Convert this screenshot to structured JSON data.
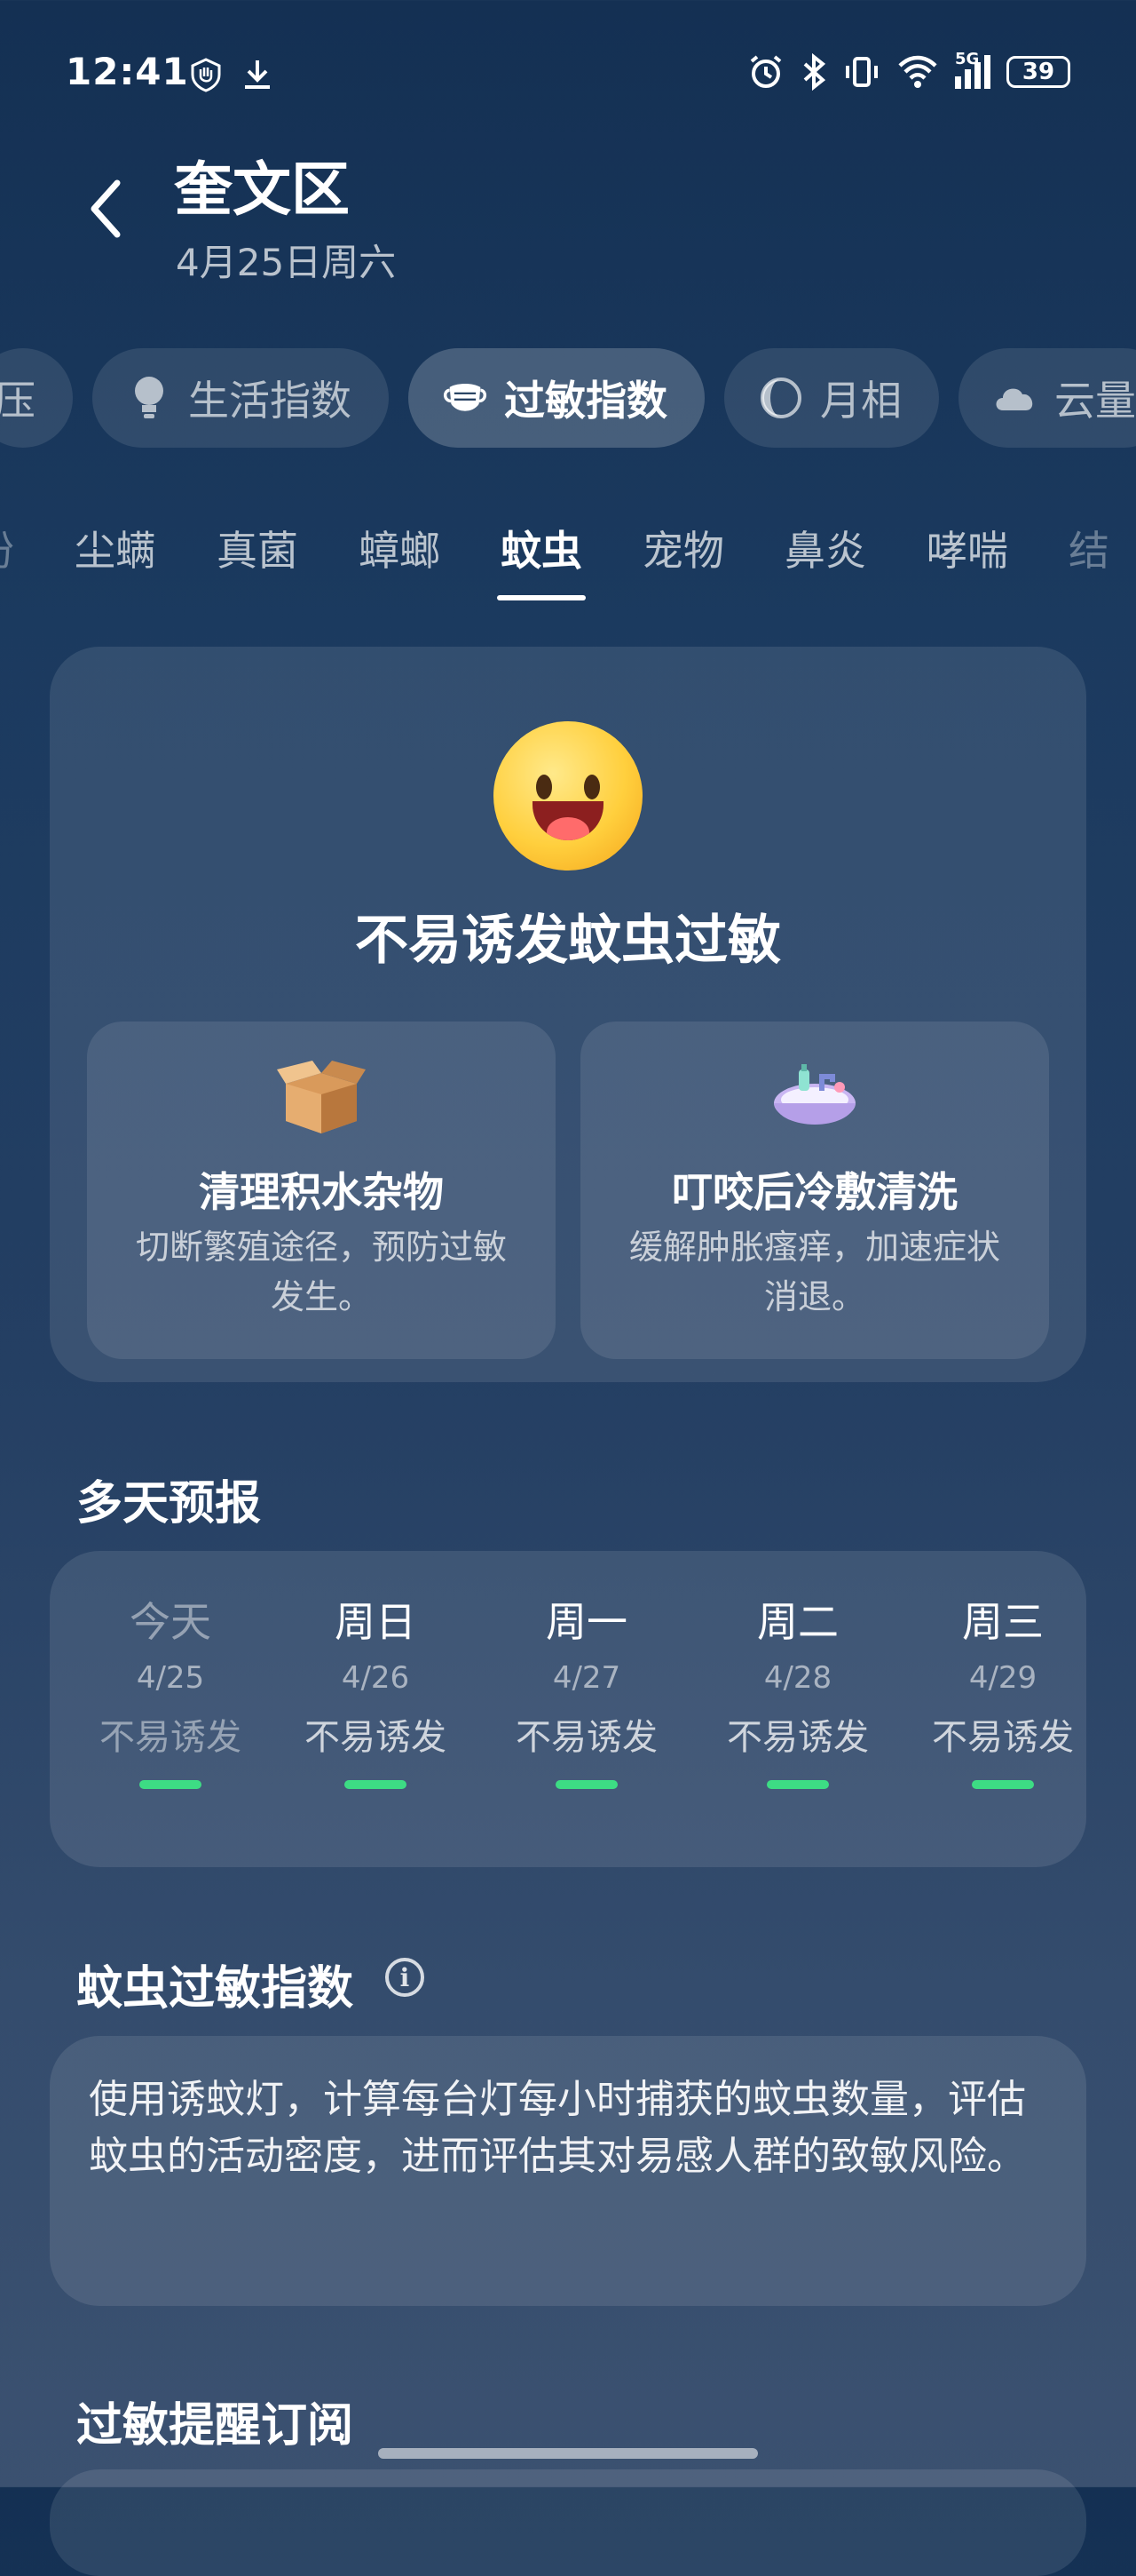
{
  "status_bar": {
    "time": "12:41",
    "network": "5G",
    "battery": "39"
  },
  "header": {
    "title": "奎文区",
    "date": "4月25日周六"
  },
  "categories": [
    {
      "label": "压",
      "icon": "gauge-icon"
    },
    {
      "label": "生活指数",
      "icon": "lightbulb-icon"
    },
    {
      "label": "过敏指数",
      "icon": "mask-icon",
      "active": true
    },
    {
      "label": "月相",
      "icon": "moon-icon"
    },
    {
      "label": "云量",
      "icon": "cloud-icon"
    }
  ],
  "allergen_tabs": [
    {
      "label": "粉"
    },
    {
      "label": "尘螨"
    },
    {
      "label": "真菌"
    },
    {
      "label": "蟑螂"
    },
    {
      "label": "蚊虫",
      "active": true
    },
    {
      "label": "宠物"
    },
    {
      "label": "鼻炎"
    },
    {
      "label": "哮喘"
    },
    {
      "label": "结"
    }
  ],
  "summary": {
    "headline": "不易诱发蚊虫过敏",
    "tips": [
      {
        "icon": "box-icon",
        "title": "清理积水杂物",
        "desc": "切断繁殖途径，预防过敏发生。"
      },
      {
        "icon": "sink-icon",
        "title": "叮咬后冷敷清洗",
        "desc": "缓解肿胀瘙痒，加速症状消退。"
      }
    ]
  },
  "forecast": {
    "title": "多天预报",
    "days": [
      {
        "name": "今天",
        "date": "4/25",
        "level": "不易诱发"
      },
      {
        "name": "周日",
        "date": "4/26",
        "level": "不易诱发"
      },
      {
        "name": "周一",
        "date": "4/27",
        "level": "不易诱发"
      },
      {
        "name": "周二",
        "date": "4/28",
        "level": "不易诱发"
      },
      {
        "name": "周三",
        "date": "4/29",
        "level": "不易诱发"
      }
    ],
    "level_color": "#3ddc84"
  },
  "index_info": {
    "title": "蚊虫过敏指数",
    "icon": "info-icon",
    "info_glyph": "i",
    "description": "使用诱蚊灯，计算每台灯每小时捕获的蚊虫数量，评估蚊虫的活动密度，进而评估其对易感人群的致敏风险。"
  },
  "subscription": {
    "title": "过敏提醒订阅"
  }
}
